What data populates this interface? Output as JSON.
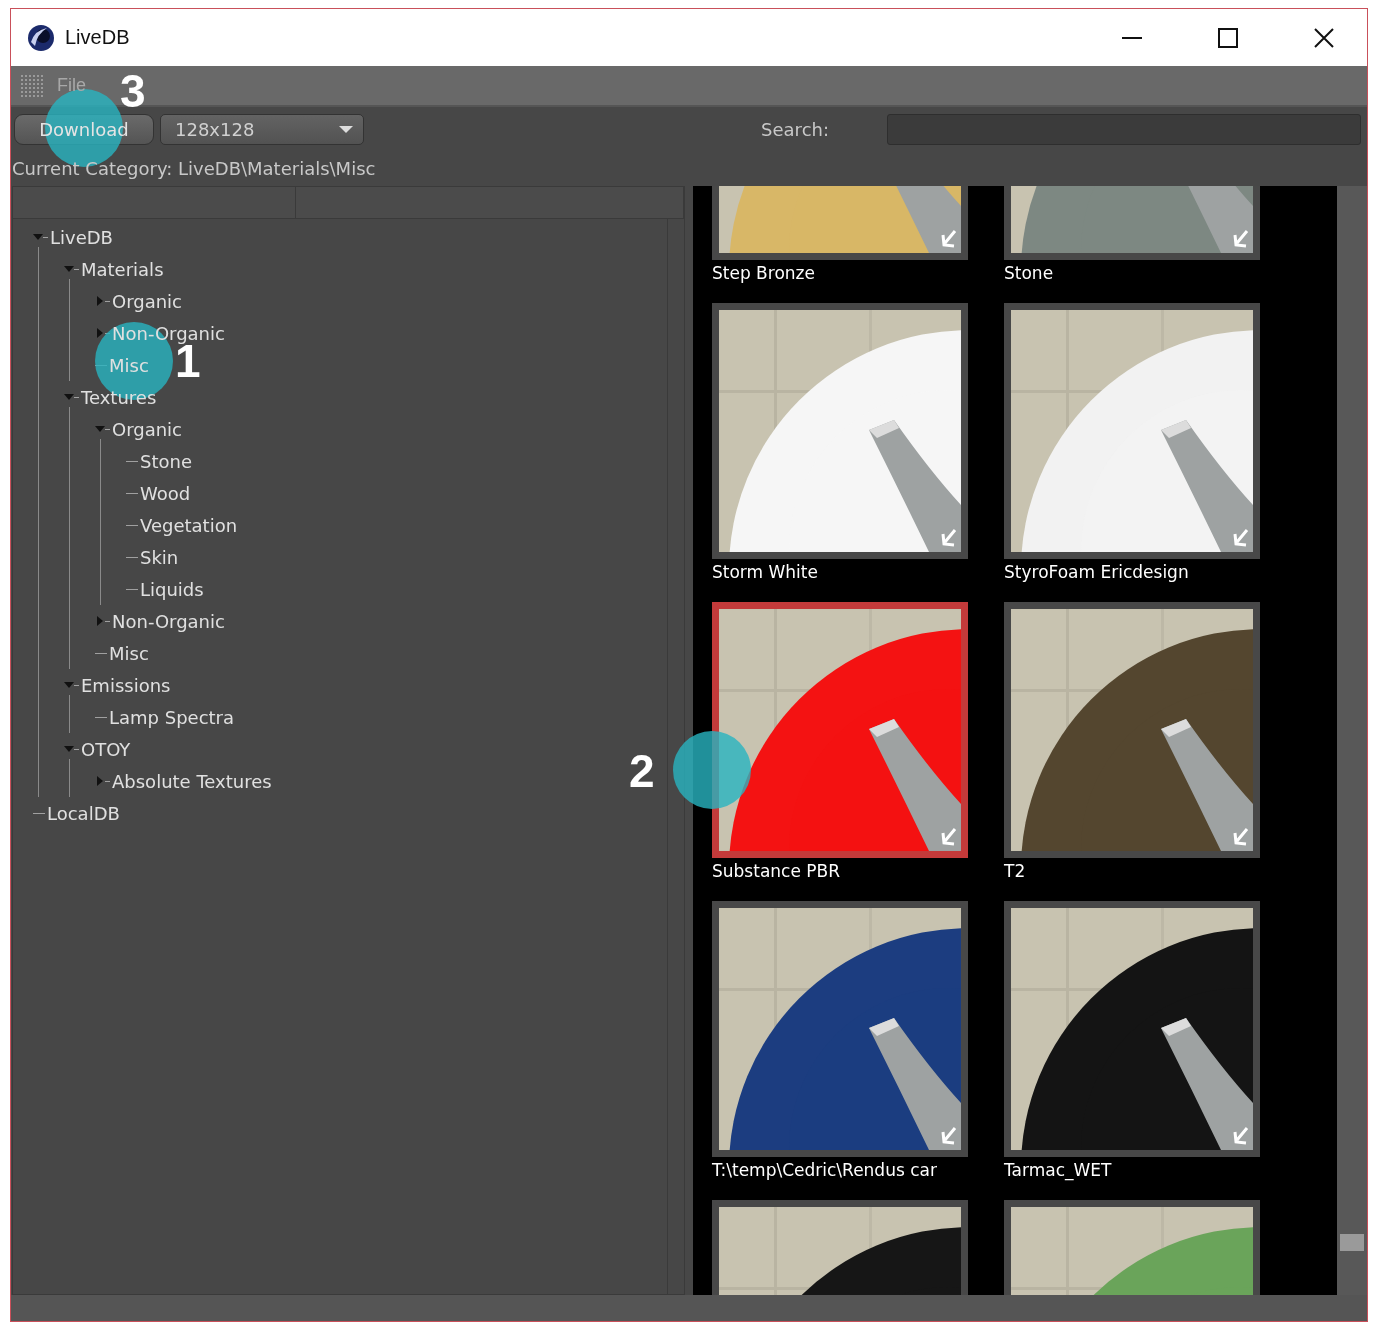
{
  "window": {
    "title": "LiveDB"
  },
  "menu": [
    "File"
  ],
  "toolbar": {
    "download_button": "Download",
    "size_select": "128x128",
    "search_label": "Search:"
  },
  "current_category": "Current Category: LiveDB\\Materials\\Misc",
  "tree": [
    {
      "label": "LiveDB",
      "kind": "folder",
      "expanded": true,
      "children": [
        {
          "label": "Materials",
          "kind": "folder",
          "expanded": true,
          "children": [
            {
              "label": "Organic",
              "kind": "folder",
              "expanded": false
            },
            {
              "label": "Non-Organic",
              "kind": "folder",
              "expanded": false
            },
            {
              "label": "Misc",
              "kind": "leaf"
            }
          ]
        },
        {
          "label": "Textures",
          "kind": "folder",
          "expanded": true,
          "children": [
            {
              "label": "Organic",
              "kind": "folder",
              "expanded": true,
              "children": [
                {
                  "label": "Stone",
                  "kind": "leaf"
                },
                {
                  "label": "Wood",
                  "kind": "leaf"
                },
                {
                  "label": "Vegetation",
                  "kind": "leaf"
                },
                {
                  "label": "Skin",
                  "kind": "leaf"
                },
                {
                  "label": "Liquids",
                  "kind": "leaf"
                }
              ]
            },
            {
              "label": "Non-Organic",
              "kind": "folder",
              "expanded": false
            },
            {
              "label": "Misc",
              "kind": "leaf"
            }
          ]
        },
        {
          "label": "Emissions",
          "kind": "folder",
          "expanded": true,
          "children": [
            {
              "label": "Lamp Spectra",
              "kind": "leaf"
            }
          ]
        },
        {
          "label": "OTOY",
          "kind": "folder",
          "expanded": true,
          "children": [
            {
              "label": "Absolute Textures",
              "kind": "folder",
              "expanded": false
            }
          ]
        }
      ]
    },
    {
      "label": "LocalDB",
      "kind": "leaf"
    }
  ],
  "materials": [
    {
      "name": "Step Bronze",
      "selected": false
    },
    {
      "name": "Stone",
      "selected": false
    },
    {
      "name": "Storm White",
      "selected": false
    },
    {
      "name": "StyroFoam Ericdesign",
      "selected": false
    },
    {
      "name": "Substance PBR",
      "selected": true
    },
    {
      "name": "T2",
      "selected": false
    },
    {
      "name": "T:\\temp\\Cedric\\Rendus car",
      "selected": false
    },
    {
      "name": "Tarmac_WET",
      "selected": false
    },
    {
      "selected": false
    },
    {
      "selected": false
    }
  ],
  "callouts": [
    {
      "label": "3"
    },
    {
      "label": "1"
    },
    {
      "label": "2"
    }
  ]
}
